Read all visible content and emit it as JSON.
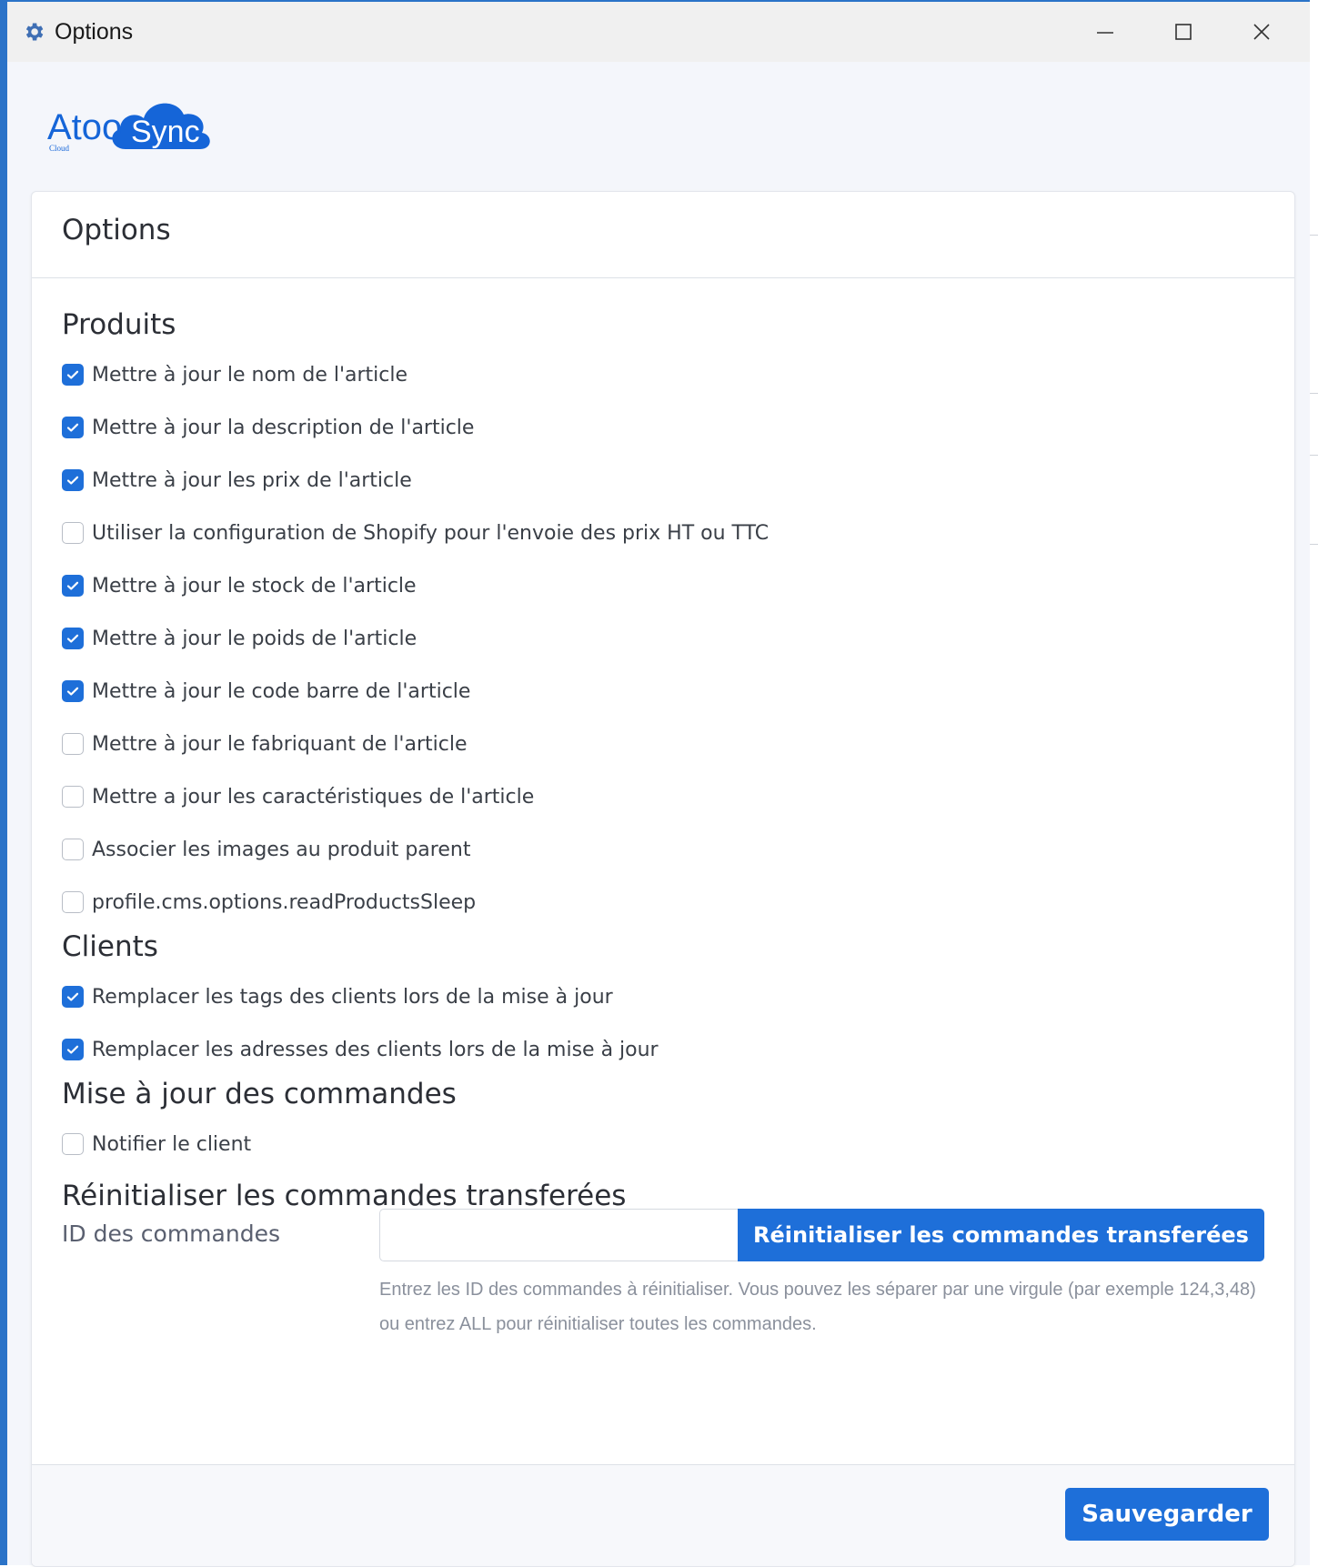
{
  "window": {
    "title": "Options",
    "controls": {
      "minimize": "minimize-icon",
      "maximize": "maximize-icon",
      "close": "close-icon"
    }
  },
  "logo": {
    "text_left": "Atoo",
    "text_cloud": "Sync",
    "subtext": "Cloud"
  },
  "card": {
    "title": "Options"
  },
  "sections": {
    "produits": {
      "title": "Produits",
      "items": [
        {
          "label": "Mettre à jour le nom de l'article",
          "checked": true
        },
        {
          "label": "Mettre à jour la description de l'article",
          "checked": true
        },
        {
          "label": "Mettre à jour les prix de l'article",
          "checked": true
        },
        {
          "label": "Utiliser la configuration de Shopify pour l'envoie des prix HT ou TTC",
          "checked": false
        },
        {
          "label": "Mettre à jour le stock de l'article",
          "checked": true
        },
        {
          "label": "Mettre à jour le poids de l'article",
          "checked": true
        },
        {
          "label": "Mettre à jour le code barre de l'article",
          "checked": true
        },
        {
          "label": "Mettre à jour le fabriquant de l'article",
          "checked": false
        },
        {
          "label": "Mettre a jour les caractéristiques de l'article",
          "checked": false
        },
        {
          "label": "Associer les images au produit parent",
          "checked": false
        },
        {
          "label": "profile.cms.options.readProductsSleep",
          "checked": false
        }
      ]
    },
    "clients": {
      "title": "Clients",
      "items": [
        {
          "label": "Remplacer les tags des clients lors de la mise à jour",
          "checked": true
        },
        {
          "label": "Remplacer les adresses des clients lors de la mise à jour",
          "checked": true
        }
      ]
    },
    "commandes": {
      "title": "Mise à jour des commandes",
      "items": [
        {
          "label": "Notifier le client",
          "checked": false
        }
      ]
    },
    "reinit": {
      "title": "Réinitialiser les commandes transferées",
      "field_label": "ID des commandes",
      "input_value": "",
      "button_label": "Réinitialiser les commandes transferées",
      "help_text": "Entrez les ID des commandes à réinitialiser. Vous pouvez les séparer par une virgule (par exemple 124,3,48) ou entrez ALL pour réinitialiser toutes les commandes."
    }
  },
  "footer": {
    "save_label": "Sauvegarder"
  },
  "colors": {
    "accent": "#1e6fd9",
    "window_border": "#2b73c8",
    "logo_blue": "#1565d8"
  }
}
